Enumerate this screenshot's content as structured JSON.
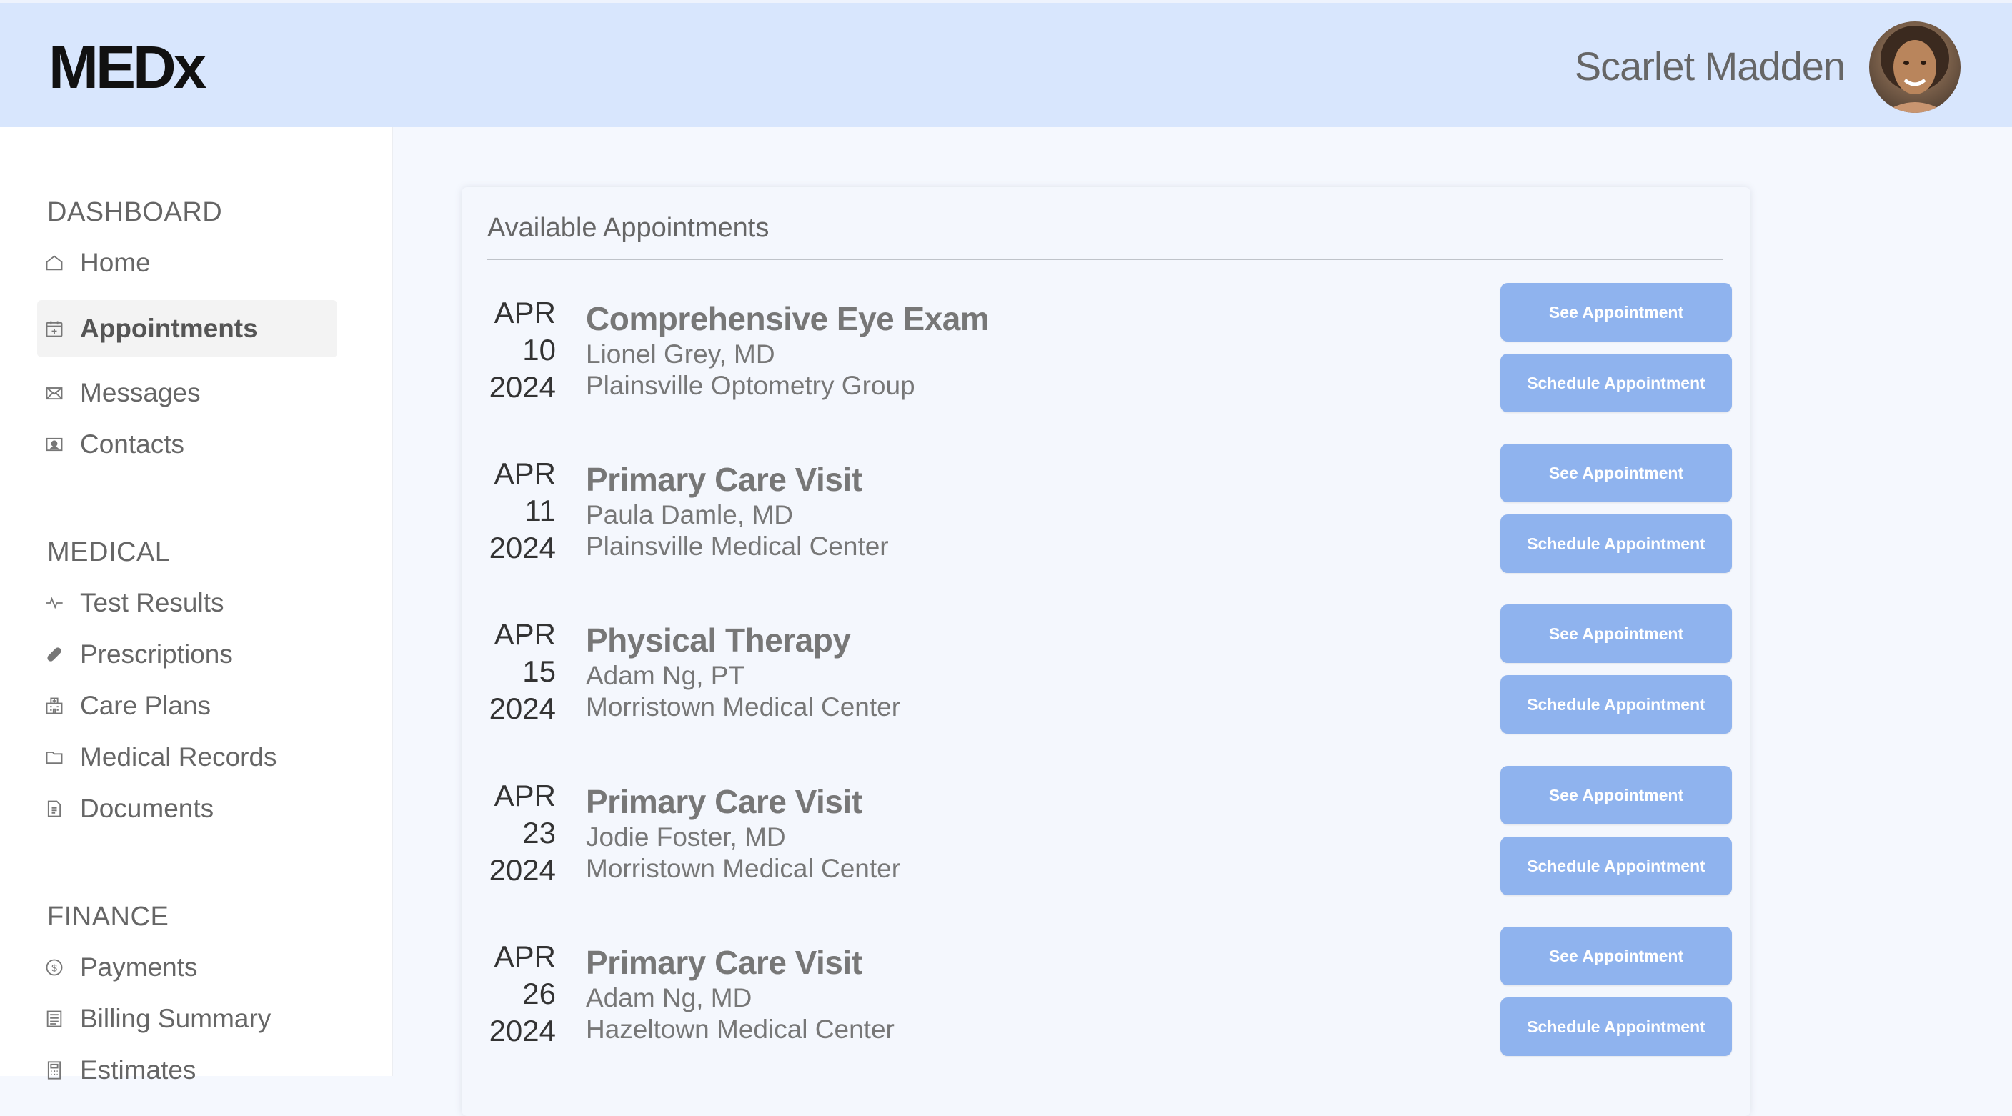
{
  "app": {
    "logo": "MEDx"
  },
  "user": {
    "name": "Scarlet Madden"
  },
  "sidebar": {
    "sections": [
      {
        "title": "DASHBOARD",
        "items": [
          {
            "label": "Home",
            "icon": "home-icon"
          },
          {
            "label": "Appointments",
            "icon": "calendar-icon",
            "active": true
          },
          {
            "label": "Messages",
            "icon": "envelope-icon"
          },
          {
            "label": "Contacts",
            "icon": "contact-card-icon"
          }
        ]
      },
      {
        "title": "MEDICAL",
        "items": [
          {
            "label": "Test Results",
            "icon": "pulse-icon"
          },
          {
            "label": "Prescriptions",
            "icon": "pill-icon"
          },
          {
            "label": "Care Plans",
            "icon": "hospital-icon"
          },
          {
            "label": "Medical Records",
            "icon": "folder-icon"
          },
          {
            "label": "Documents",
            "icon": "document-icon"
          }
        ]
      },
      {
        "title": "FINANCE",
        "items": [
          {
            "label": "Payments",
            "icon": "dollar-circle-icon"
          },
          {
            "label": "Billing Summary",
            "icon": "list-icon"
          },
          {
            "label": "Estimates",
            "icon": "calculator-icon"
          }
        ]
      }
    ]
  },
  "main": {
    "title": "Available Appointments",
    "see_label": "See Appointment",
    "schedule_label": "Schedule Appointment",
    "appointments": [
      {
        "month": "APR",
        "day": "10",
        "year": "2024",
        "title": "Comprehensive Eye Exam",
        "provider": "Lionel Grey, MD",
        "location": "Plainsville Optometry Group"
      },
      {
        "month": "APR",
        "day": "11",
        "year": "2024",
        "title": "Primary Care Visit",
        "provider": "Paula Damle, MD",
        "location": "Plainsville Medical Center"
      },
      {
        "month": "APR",
        "day": "15",
        "year": "2024",
        "title": "Physical Therapy",
        "provider": "Adam Ng, PT",
        "location": "Morristown Medical Center"
      },
      {
        "month": "APR",
        "day": "23",
        "year": "2024",
        "title": "Primary Care Visit",
        "provider": "Jodie Foster, MD",
        "location": "Morristown Medical Center"
      },
      {
        "month": "APR",
        "day": "26",
        "year": "2024",
        "title": "Primary Care Visit",
        "provider": "Adam Ng, MD",
        "location": "Hazeltown Medical Center"
      }
    ]
  },
  "colors": {
    "header_bg": "#d8e6fd",
    "page_bg": "#f5f8fe",
    "button_bg": "#8fb3ee",
    "active_nav_bg": "#f3f3f3"
  }
}
